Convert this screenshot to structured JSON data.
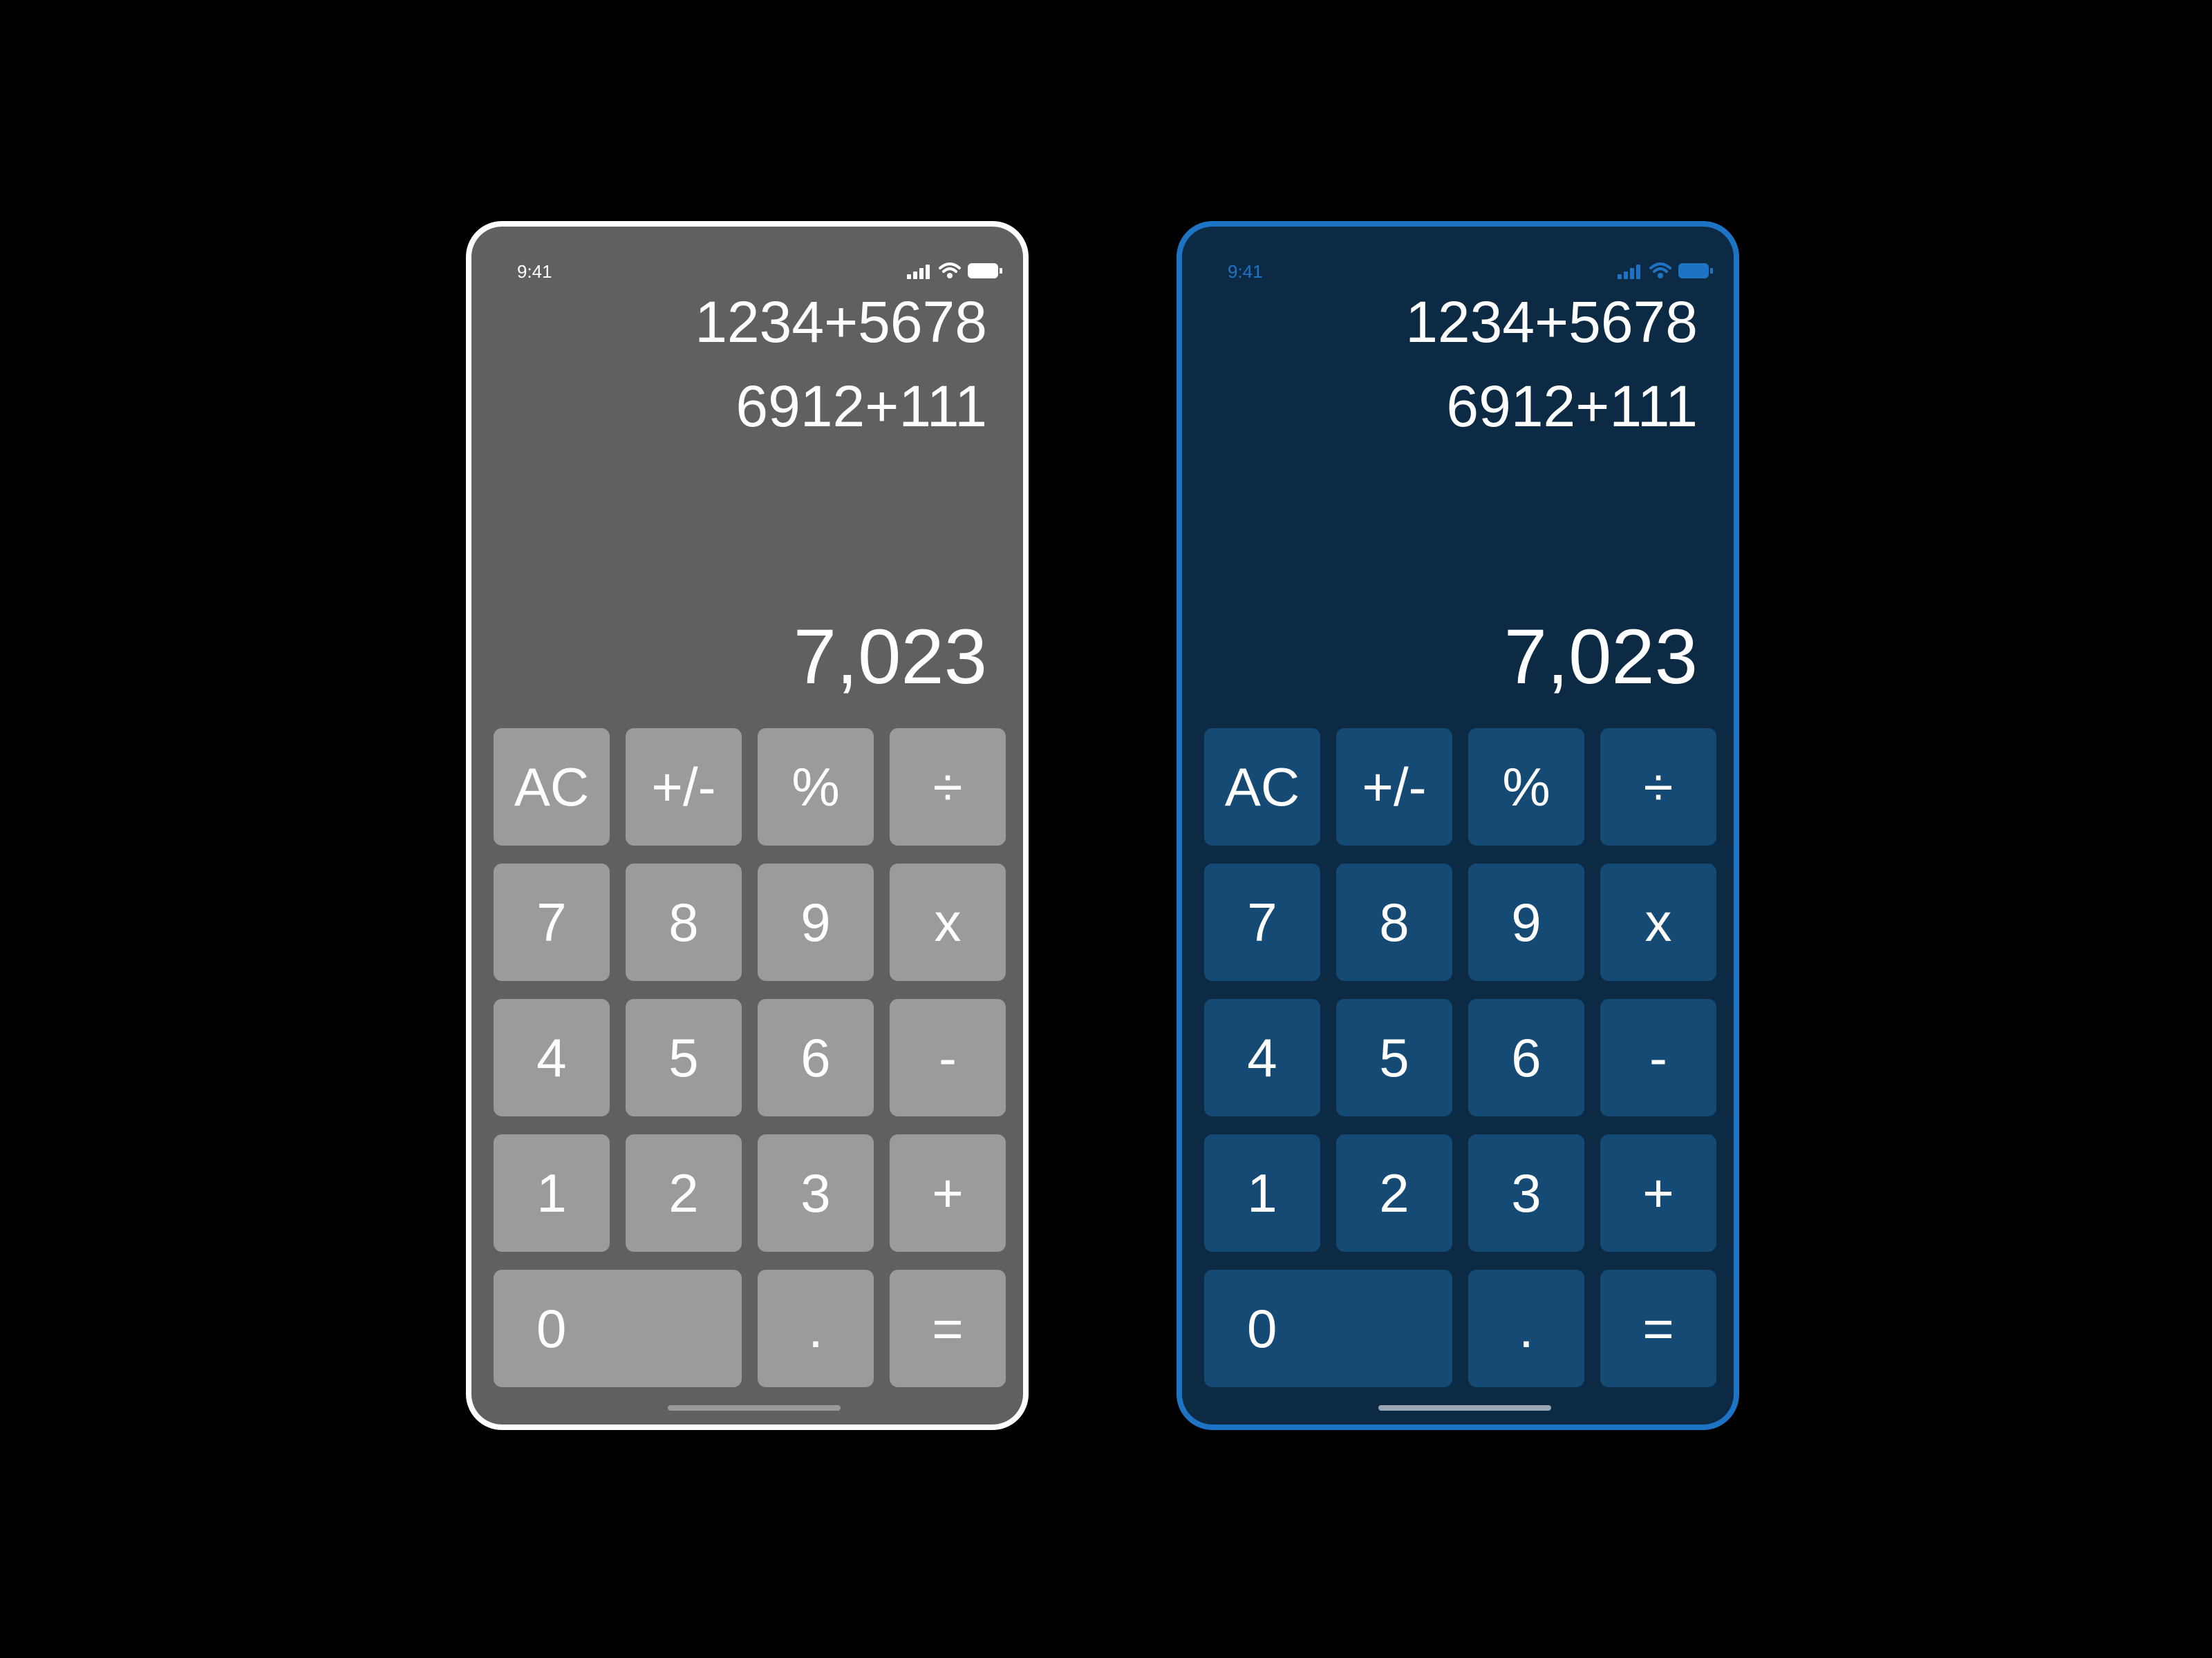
{
  "colors": {
    "page_background": "#000000",
    "gray_theme": {
      "screen": "#606060",
      "frame": "#ffffff",
      "key": "#9b9b9b",
      "status": "#ffffff"
    },
    "blue_theme": {
      "screen": "#0d2a45",
      "frame": "#1e74c4",
      "key": "#154a75",
      "status": "#1e74c4"
    }
  },
  "icons": [
    "signal-icon",
    "wifi-icon",
    "battery-icon"
  ],
  "phones": [
    {
      "theme": "gray",
      "status_time": "9:41",
      "expression_1": "1234+5678",
      "expression_2": "6912+111",
      "result": "7,023",
      "keys": [
        "AC",
        "+/-",
        "%",
        "÷",
        "7",
        "8",
        "9",
        "x",
        "4",
        "5",
        "6",
        "-",
        "1",
        "2",
        "3",
        "+",
        "0",
        ".",
        "="
      ]
    },
    {
      "theme": "blue",
      "status_time": "9:41",
      "expression_1": "1234+5678",
      "expression_2": "6912+111",
      "result": "7,023",
      "keys": [
        "AC",
        "+/-",
        "%",
        "÷",
        "7",
        "8",
        "9",
        "x",
        "4",
        "5",
        "6",
        "-",
        "1",
        "2",
        "3",
        "+",
        "0",
        ".",
        "="
      ]
    }
  ]
}
